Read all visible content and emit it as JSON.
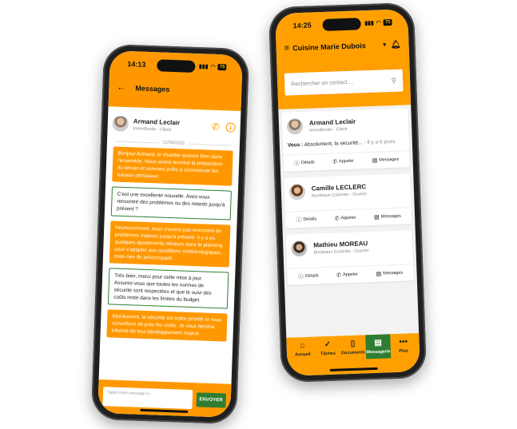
{
  "left_phone": {
    "time": "14:13",
    "title": "Messages",
    "contact": {
      "name": "Armand Leclair",
      "subtitle": "ImmoBordo - Client"
    },
    "date_divider": "21/09/2023",
    "messages": [
      {
        "direction": "out",
        "text": "Bonjour Armand, le chantier avance bien dans l'ensemble. Nous avons terminé la préparation du terrain et sommes prêts à commencer les travaux principaux."
      },
      {
        "direction": "in",
        "text": "C'est une excellente nouvelle. Avez-vous rencontré des problèmes ou des retards jusqu'à présent ?"
      },
      {
        "direction": "out",
        "text": "Heureusement, nous n'avons pas rencontré de problèmes majeurs jusqu'à présent. Il y a eu quelques ajustements mineurs dans le planning pour s'adapter aux conditions météorologiques, mais rien de préoccupant."
      },
      {
        "direction": "in",
        "text": "Très bien, merci pour cette mise à jour. Assurez-vous que toutes les normes de sécurité sont respectées et que le suivi des coûts reste dans les limites du budget."
      },
      {
        "direction": "out",
        "text": "Absolument, la sécurité est notre priorité et nous surveillons de près les coûts. Je vous tiendrai informé de tout développement majeur."
      }
    ],
    "composer": {
      "placeholder": "Tapez votre message ici",
      "send_label": "ENVOYER"
    }
  },
  "right_phone": {
    "time": "14:25",
    "title": "Cuisine Marie Dubois",
    "search_placeholder": "Rechercher un contact ...",
    "contacts": [
      {
        "name": "Armand Leclair",
        "subtitle": "ImmoBordo - Client",
        "last_prefix": "Vous :",
        "last_text": "Absolument, la sécurité...",
        "last_ago": "- Il y a 6 jours"
      },
      {
        "name": "Camille LECLERC",
        "subtitle": "Bordeaux Cuisines - Ouvrier"
      },
      {
        "name": "Mathieu MOREAU",
        "subtitle": "Bordeaux Cuisines - Ouvrier"
      }
    ],
    "card_actions": {
      "details": "Détails",
      "call": "Appeler",
      "messages": "Messages"
    },
    "nav": [
      {
        "label": "Accueil",
        "icon": "home-icon",
        "active": false
      },
      {
        "label": "Tâches",
        "icon": "check-circle-icon",
        "active": false
      },
      {
        "label": "Documents",
        "icon": "document-icon",
        "active": false
      },
      {
        "label": "Messagerie",
        "icon": "chat-icon",
        "active": true
      },
      {
        "label": "Plus",
        "icon": "more-icon",
        "active": false
      }
    ]
  },
  "colors": {
    "primary": "#ff9800",
    "accent_green": "#2e7d32",
    "background": "#f2f2f2"
  }
}
